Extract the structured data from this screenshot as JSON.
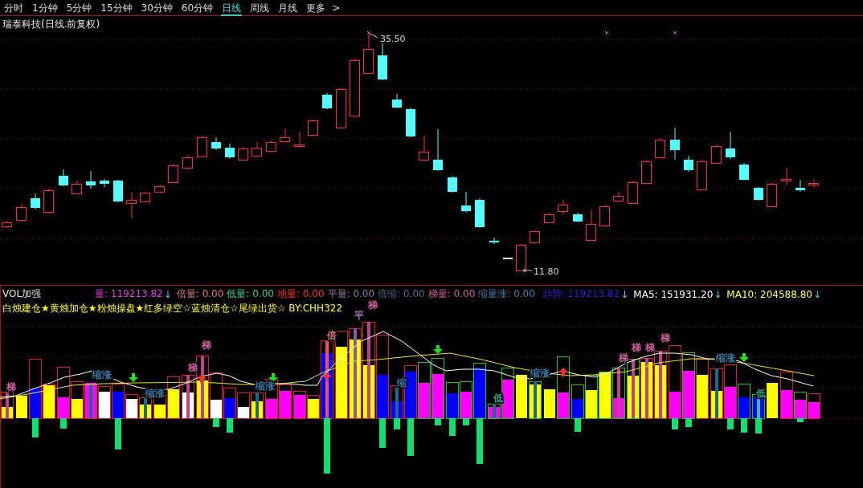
{
  "tabs": [
    {
      "label": "分时",
      "selected": false
    },
    {
      "label": "1分钟",
      "selected": false
    },
    {
      "label": "5分钟",
      "selected": false
    },
    {
      "label": "15分钟",
      "selected": false
    },
    {
      "label": "30分钟",
      "selected": false
    },
    {
      "label": "60分钟",
      "selected": false
    },
    {
      "label": "日线",
      "selected": true
    },
    {
      "label": "周线",
      "selected": false
    },
    {
      "label": "月线",
      "selected": false
    }
  ],
  "more_button": {
    "label": "更多",
    "chevron": ">"
  },
  "chart_title": "瑞泰科技(日线.前复权)",
  "price_chart": {
    "high_label": "35.50",
    "low_label": "11.80"
  },
  "indicator": {
    "name": "VOL加强",
    "readings": [
      {
        "text": "量: 119213.82",
        "color": "#e040e0",
        "arrow": "↓"
      },
      {
        "text": "倍量: 0.00",
        "color": "#e08070"
      },
      {
        "text": "低量: 0.00",
        "color": "#40d080"
      },
      {
        "text": "地量: 0.00",
        "color": "#ff3030"
      },
      {
        "text": "平量: 0.00",
        "color": "#9a78b0"
      },
      {
        "text": "倍缩: 0.00",
        "color": "#4a6a96"
      },
      {
        "text": "梯量: 0.00",
        "color": "#d060a0"
      },
      {
        "text": "缩量涨: 0.00",
        "color": "#4a80a8"
      }
    ],
    "trend_readings": [
      {
        "text": "趋势: 119213.82",
        "color": "#2828d0",
        "arrow": "↓"
      },
      {
        "text": "MA5: 151931.20",
        "color": "#ffffff",
        "arrow": "↓"
      },
      {
        "text": "MA10: 204588.80",
        "color": "#ffff60",
        "arrow": "↓"
      }
    ],
    "legend_line": "白烛建仓★黄烛加仓★粉烛操盘★红多绿空☆蓝烛清仓☆尾绿出货☆ BY:CHH322",
    "annotations": [
      {
        "text": "梯",
        "color": "#d060a0"
      },
      {
        "text": "缩涨",
        "color": "#3a7aa8"
      },
      {
        "text": "缩涨",
        "color": "#3a7aa8"
      },
      {
        "text": "梯",
        "color": "#d060a0"
      },
      {
        "text": "梯",
        "color": "#d060a0"
      },
      {
        "text": "缩涨",
        "color": "#3a7aa8"
      },
      {
        "text": "倍",
        "color": "#e08070"
      },
      {
        "text": "平",
        "color": "#9a78b0"
      },
      {
        "text": "梯",
        "color": "#d060a0"
      },
      {
        "text": "缩",
        "color": "#3a7aa8"
      },
      {
        "text": "低",
        "color": "#30a890"
      },
      {
        "text": "缩涨",
        "color": "#3a7aa8"
      },
      {
        "text": "梯",
        "color": "#d060a0"
      },
      {
        "text": "梯",
        "color": "#d060a0"
      },
      {
        "text": "梯",
        "color": "#d060a0"
      },
      {
        "text": "梯",
        "color": "#d060a0"
      },
      {
        "text": "缩涨",
        "color": "#3a7aa8"
      },
      {
        "text": "低",
        "color": "#30a890"
      }
    ]
  }
}
